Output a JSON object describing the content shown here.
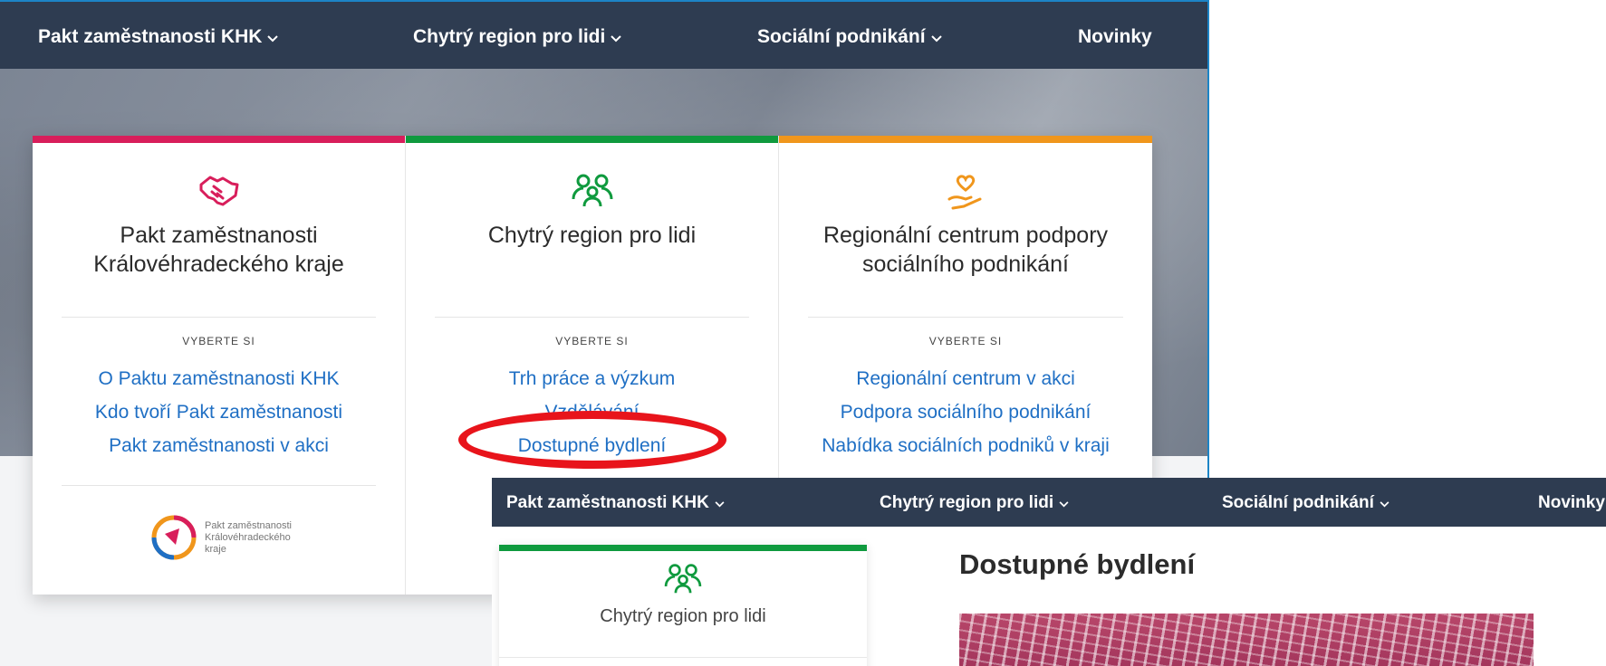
{
  "nav": {
    "items": [
      "Pakt zaměstnanosti KHK",
      "Chytrý region pro lidi",
      "Sociální podnikání",
      "Novinky"
    ]
  },
  "cards": [
    {
      "title_line1": "Pakt zaměstnanosti",
      "title_line2": "Královéhradeckého kraje",
      "choose": "VYBERTE SI",
      "links": [
        "O Paktu zaměstnanosti KHK",
        "Kdo tvoří Pakt zaměstnanosti",
        "Pakt zaměstnanosti v akci"
      ],
      "logo_text": [
        "Pakt zaměstnanosti",
        "Královéhradeckého",
        "kraje"
      ],
      "accent": "#d81e5b",
      "icon": "handshake-icon"
    },
    {
      "title_line1": "Chytrý region pro lidi",
      "title_line2": "",
      "choose": "VYBERTE SI",
      "links": [
        "Trh práce a výzkum",
        "Vzdělávání",
        "Dostupné bydlení"
      ],
      "accent": "#0f9a3e",
      "icon": "people-icon"
    },
    {
      "title_line1": "Regionální centrum podpory",
      "title_line2": "sociálního podnikání",
      "choose": "VYBERTE SI",
      "links": [
        "Regionální centrum v akci",
        "Podpora sociálního podnikání",
        "Nabídka sociálních podniků v kraji"
      ],
      "accent": "#f0961c",
      "icon": "heart-hand-icon"
    }
  ],
  "second": {
    "nav_items": [
      "Pakt zaměstnanosti KHK",
      "Chytrý region pro lidi",
      "Sociální podnikání",
      "Novinky"
    ],
    "side_title": "Chytrý region pro lidi",
    "page_title": "Dostupné bydlení"
  },
  "colors": {
    "nav_bg": "#2e3c51",
    "link": "#1f6fc4",
    "highlight": "#e8141b"
  }
}
